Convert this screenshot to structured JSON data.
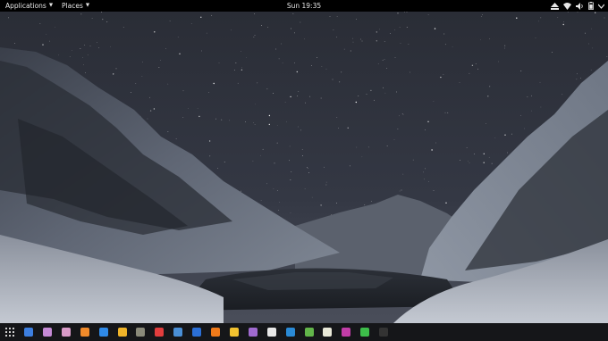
{
  "topbar": {
    "applications_label": "Applications",
    "places_label": "Places",
    "clock": "Sun 19:35"
  },
  "tray_icons": [
    "eject-icon",
    "wifi-icon",
    "volume-icon",
    "battery-icon",
    "power-menu-icon"
  ],
  "dock": {
    "apps_grid_icon": "show-applications-icon",
    "items": [
      {
        "name": "dock-item-1",
        "color": "#3d7fe0"
      },
      {
        "name": "dock-item-2",
        "color": "#c58ad6"
      },
      {
        "name": "dock-item-3",
        "color": "#d99bc9"
      },
      {
        "name": "dock-item-4",
        "color": "#f08a2a"
      },
      {
        "name": "dock-item-5",
        "color": "#2f8ae8"
      },
      {
        "name": "dock-item-6",
        "color": "#f0b429"
      },
      {
        "name": "dock-item-7",
        "color": "#8a8a7a"
      },
      {
        "name": "dock-item-8",
        "color": "#e23d3d"
      },
      {
        "name": "dock-item-9",
        "color": "#4a8fd6"
      },
      {
        "name": "dock-item-10",
        "color": "#2b6fd6"
      },
      {
        "name": "dock-item-11",
        "color": "#f07a1a"
      },
      {
        "name": "dock-item-12",
        "color": "#f2c230"
      },
      {
        "name": "dock-item-13",
        "color": "#a06ad0"
      },
      {
        "name": "dock-item-14",
        "color": "#e8e8e8"
      },
      {
        "name": "dock-item-15",
        "color": "#2a8ad6"
      },
      {
        "name": "dock-item-16",
        "color": "#62b54a"
      },
      {
        "name": "dock-item-17",
        "color": "#e8e8d8"
      },
      {
        "name": "dock-item-18",
        "color": "#c23da8"
      },
      {
        "name": "dock-item-19",
        "color": "#3dbd4a"
      },
      {
        "name": "dock-item-20",
        "color": "#333333"
      }
    ]
  }
}
